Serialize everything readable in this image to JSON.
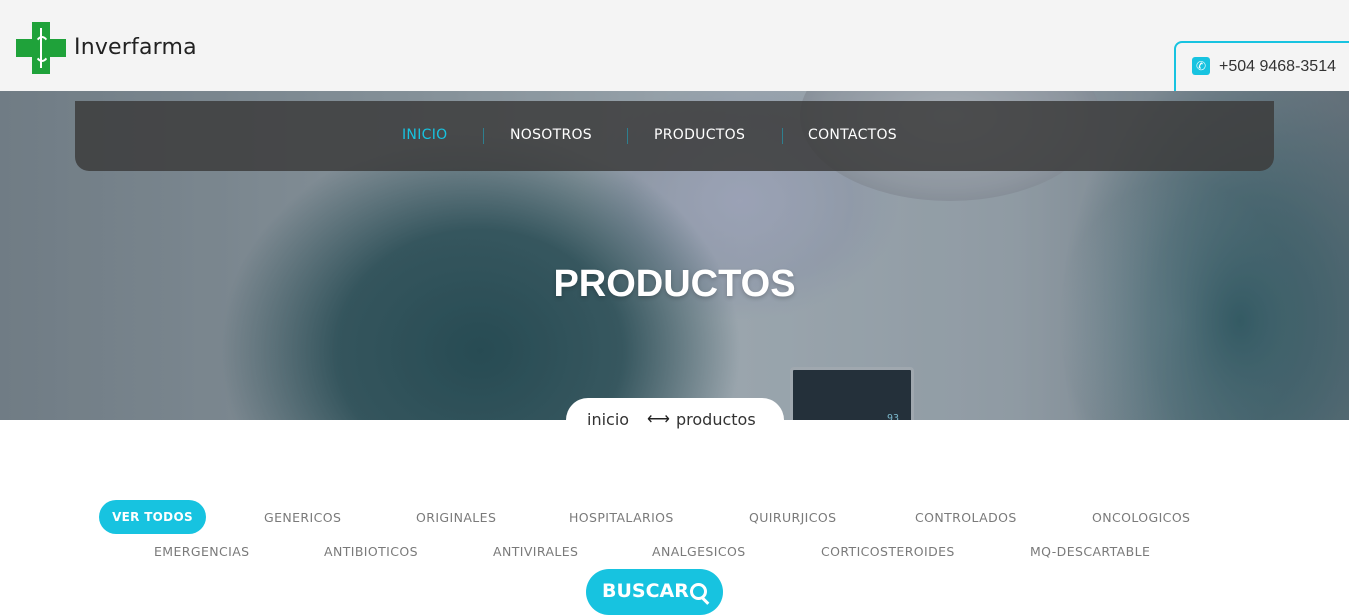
{
  "brand": {
    "name": "Inverfarma",
    "phone": "+504 9468-3514"
  },
  "nav": {
    "items": [
      "INICIO",
      "NOSOTROS",
      "PRODUCTOS",
      "CONTACTOS"
    ],
    "active": "INICIO"
  },
  "hero": {
    "title": "PRODUCTOS",
    "monitor_value": "93"
  },
  "breadcrumb": {
    "home": "inicio",
    "current": "productos"
  },
  "filters": {
    "active": "VER TODOS",
    "row1": [
      "GENERICOS",
      "ORIGINALES",
      "HOSPITALARIOS",
      "QUIRURJICOS",
      "CONTROLADOS",
      "ONCOLOGICOS"
    ],
    "row2": [
      "EMERGENCIAS",
      "ANTIBIOTICOS",
      "ANTIVIRALES",
      "ANALGESICOS",
      "CORTICOSTEROIDES",
      "MQ-DESCARTABLE"
    ]
  },
  "search": {
    "label": "BUSCAR"
  },
  "colors": {
    "accent": "#17c3e0",
    "logo_green": "#1fa23a"
  }
}
